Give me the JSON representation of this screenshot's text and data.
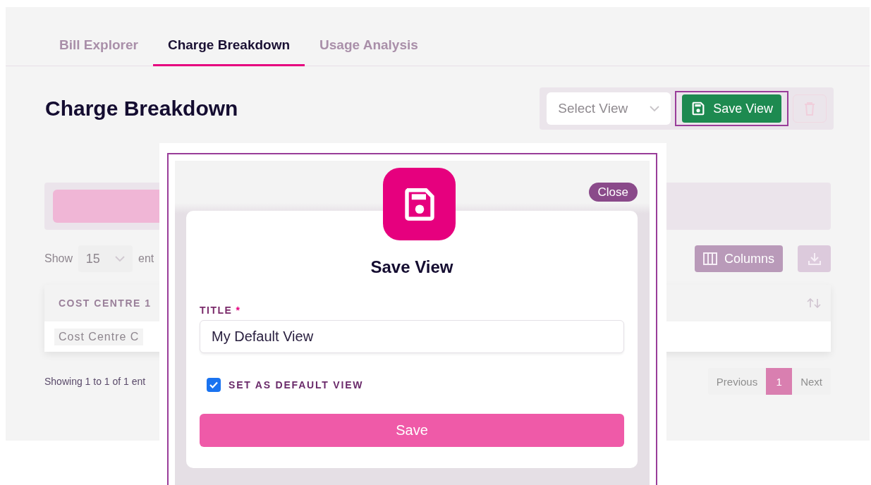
{
  "tabs": [
    {
      "label": "Bill Explorer",
      "selected": false
    },
    {
      "label": "Charge Breakdown",
      "selected": true
    },
    {
      "label": "Usage Analysis",
      "selected": false
    }
  ],
  "page_title": "Charge Breakdown",
  "view_toolbar": {
    "select_placeholder": "Select View",
    "save_label": "Save View",
    "save_highlighted": true
  },
  "length_menu": {
    "label": "Show",
    "value": "15",
    "suffix": "ent"
  },
  "columns_button": "Columns",
  "table": {
    "columns": [
      {
        "label": "COST CENTRE 1"
      }
    ],
    "rows": [
      [
        "Cost Centre C"
      ]
    ]
  },
  "info": "Showing 1 to 1 of 1 ent",
  "pagination": {
    "previous": "Previous",
    "pages": [
      {
        "label": "1",
        "selected": true
      }
    ],
    "next": "Next"
  },
  "dialog": {
    "close": "Close",
    "title": "Save View",
    "field": {
      "label": "TITLE",
      "required_mark": "*",
      "value": "My Default View"
    },
    "checkbox": {
      "label": "SET AS DEFAULT VIEW",
      "checked": true
    },
    "submit": "Save"
  }
}
